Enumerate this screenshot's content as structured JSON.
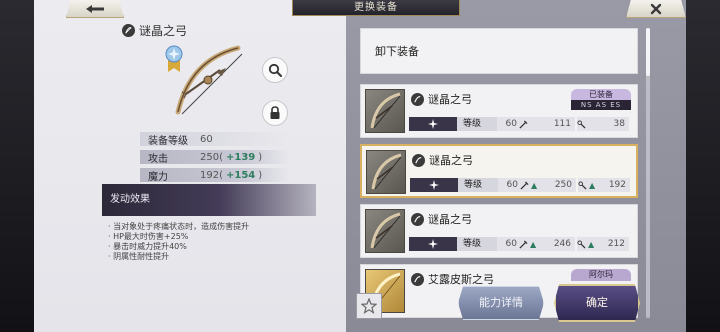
{
  "header": {
    "title": "更换装备"
  },
  "nav": {
    "back_icon": "arrow-left-icon",
    "close_icon": "close-icon"
  },
  "detail": {
    "name": "谜晶之弓",
    "stats": [
      {
        "label": "装备等级",
        "value": "60",
        "bonus": ""
      },
      {
        "label": "攻击",
        "value": "250",
        "bonus": "+139"
      },
      {
        "label": "魔力",
        "value": "192",
        "bonus": "+154"
      }
    ],
    "paren_open": "(",
    "paren_close": ")",
    "effect_title": "发动效果",
    "effects": [
      "· 当对象处于疼痛状态时，造成伤害提升",
      "· HP最大时伤害+25%",
      "· 暴击时威力提升40%",
      "· 阴属性耐性提升"
    ]
  },
  "list": {
    "unequip_label": "卸下装备",
    "level_label": "等级",
    "items": [
      {
        "name": "谜晶之弓",
        "level": "60",
        "atk": "111",
        "mag": "38",
        "atk_up": "",
        "mag_up": "",
        "badge_top": "已装备",
        "badge_bottom": "NS   AS   ES"
      },
      {
        "name": "谜晶之弓",
        "level": "60",
        "atk": "250",
        "mag": "192",
        "atk_up": "▲",
        "mag_up": "▲",
        "badge_top": "",
        "badge_bottom": ""
      },
      {
        "name": "谜晶之弓",
        "level": "60",
        "atk": "246",
        "mag": "212",
        "atk_up": "▲",
        "mag_up": "▲",
        "badge_top": "",
        "badge_bottom": ""
      },
      {
        "name": "艾露皮斯之弓",
        "level": "",
        "atk": "",
        "mag": "",
        "atk_up": "",
        "mag_up": "",
        "badge_top": "阿尔玛",
        "badge_bottom": ""
      }
    ],
    "selected_index": 1
  },
  "buttons": {
    "detail": "能力详情",
    "confirm": "确定"
  },
  "colors": {
    "accent_gold": "#d8b060",
    "bonus_green": "#2e7d5e",
    "dark_purple": "#2e2850"
  }
}
